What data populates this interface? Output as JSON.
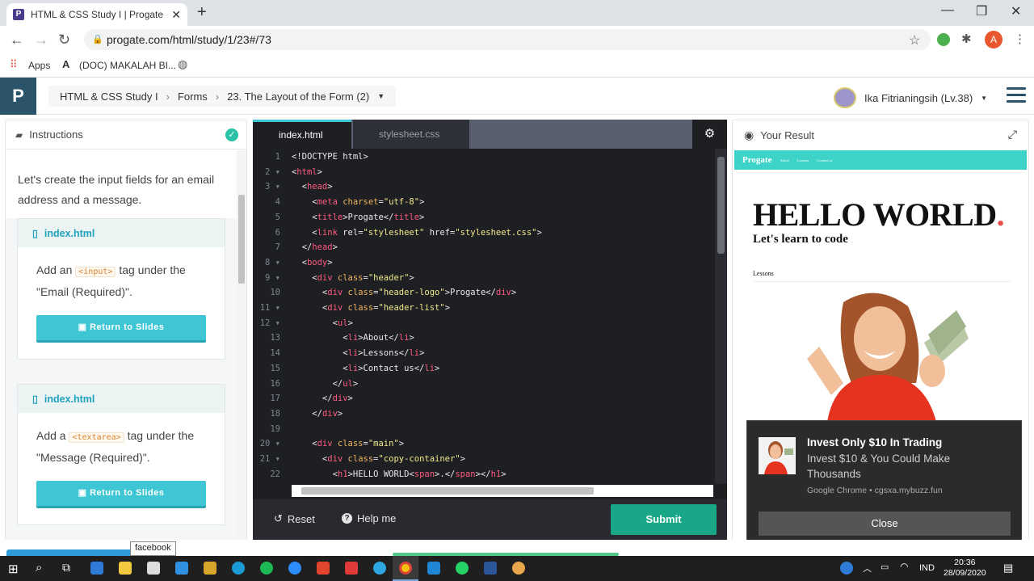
{
  "browser": {
    "tab_title": "HTML & CSS Study I | Progate - L",
    "url": "progate.com/html/study/1/23#/73",
    "bookmarks": [
      "Apps",
      "(DOC) MAKALAH BI..."
    ],
    "profile_initial": "A"
  },
  "header": {
    "logo": "P",
    "breadcrumbs": [
      "HTML & CSS Study I",
      "Forms",
      "23. The Layout of the Form (2)"
    ],
    "user_name": "Ika Fitrianingsih (Lv.38)"
  },
  "instructions": {
    "title": "Instructions",
    "intro": "Let's create the input fields for an email address and a message.",
    "cards": [
      {
        "file": "index.html",
        "text_before": "Add an",
        "tag": "<input>",
        "text_after": "tag under the \"Email (Required)\".",
        "button": "Return to Slides"
      },
      {
        "file": "index.html",
        "text_before": "Add a",
        "tag": "<textarea>",
        "text_after": "tag under the \"Message (Required)\".",
        "button": "Return to Slides"
      }
    ]
  },
  "editor": {
    "tabs": [
      "index.html",
      "stylesheet.css"
    ],
    "reset_label": "Reset",
    "help_label": "Help me",
    "submit_label": "Submit"
  },
  "result": {
    "title": "Your Result",
    "nav_brand": "Progate",
    "nav_links": [
      "About",
      "Lessons",
      "Contact us"
    ],
    "headline": "HELLO WORLD",
    "headline_dot": ".",
    "subhead": "Let's learn to code",
    "section": "Lessons"
  },
  "notification": {
    "title": "Invest Only $10 In Trading",
    "text": "Invest $10 & You Could Make Thousands",
    "source": "Google Chrome • cgsxa.mybuzz.fun",
    "close_label": "Close"
  },
  "tooltip": "facebook",
  "taskbar": {
    "lang": "IND",
    "time": "20:36",
    "date": "28/09/2020"
  },
  "colors": {
    "brand": "#2b546a",
    "accent": "#3fc6d4",
    "submit": "#18a887",
    "preview_nav": "#3ed3c9"
  }
}
